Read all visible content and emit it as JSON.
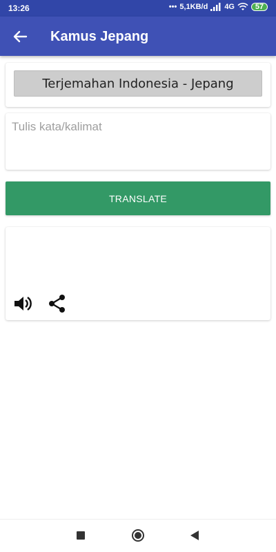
{
  "status_bar": {
    "time": "13:26",
    "network_speed": "5,1KB/d",
    "network_type": "4G",
    "battery": "57"
  },
  "app_bar": {
    "title": "Kamus Jepang"
  },
  "language_selector": {
    "label": "Terjemahan Indonesia - Jepang"
  },
  "input": {
    "placeholder": "Tulis kata/kalimat",
    "value": ""
  },
  "translate_button": {
    "label": "TRANSLATE",
    "color": "#339966"
  },
  "output": {
    "text": ""
  },
  "colors": {
    "primary": "#3f51b5",
    "primary_dark": "#3146a8",
    "accent": "#339966"
  }
}
